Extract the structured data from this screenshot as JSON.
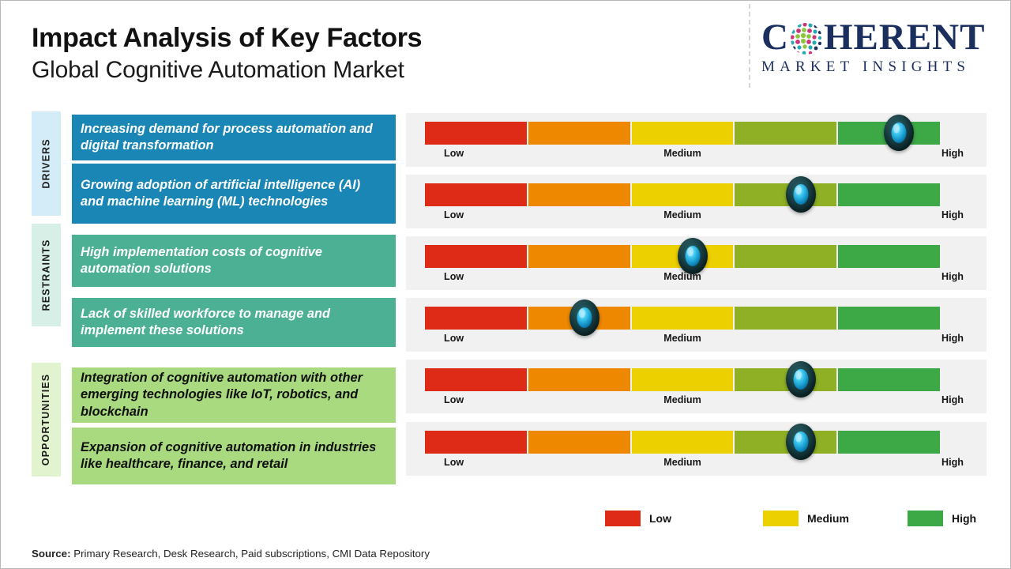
{
  "header": {
    "title": "Impact Analysis of Key Factors",
    "subtitle": "Global Cognitive Automation Market",
    "logo": {
      "name_part1": "C",
      "name_part2": "HERENT",
      "tagline": "MARKET INSIGHTS",
      "globe_colors": [
        "#2aa9b5",
        "#8cc63f",
        "#c9347a",
        "#1b2f5e"
      ],
      "brand_color": "#1b2f5e"
    }
  },
  "categories": [
    {
      "label": "DRIVERS",
      "rail_bg": "#d4ecf7",
      "box_bg": "#1a86b5",
      "text_color": "#ffffff"
    },
    {
      "label": "RESTRAINTS",
      "rail_bg": "#d8efe8",
      "box_bg": "#4cb094",
      "text_color": "#ffffff"
    },
    {
      "label": "OPPORTUNITIES",
      "rail_bg": "#e2f3cf",
      "box_bg": "#aada7f",
      "text_color": "#101010"
    }
  ],
  "scale_labels": {
    "low": "Low",
    "medium": "Medium",
    "high": "High"
  },
  "segment_colors": [
    "#de2b18",
    "#ee8800",
    "#edd000",
    "#8fb024",
    "#3ca846"
  ],
  "rows": [
    {
      "category": 0,
      "text": "Increasing demand for process automation and digital transformation",
      "impact": "High",
      "marker_percent": 92
    },
    {
      "category": 0,
      "text": "Growing adoption of artificial intelligence (AI) and machine learning (ML) technologies",
      "impact": "High",
      "marker_percent": 73
    },
    {
      "category": 1,
      "text": "High implementation costs of cognitive automation solutions",
      "impact": "Medium",
      "marker_percent": 52
    },
    {
      "category": 1,
      "text": "Lack of skilled workforce to manage and implement these solutions",
      "impact": "Low",
      "marker_percent": 31
    },
    {
      "category": 2,
      "text": "Integration of cognitive automation with other emerging technologies like IoT, robotics, and blockchain",
      "impact": "High",
      "marker_percent": 73
    },
    {
      "category": 2,
      "text": "Expansion of cognitive automation in industries like healthcare, finance, and retail",
      "impact": "High",
      "marker_percent": 73
    }
  ],
  "legend": [
    {
      "label": "Low",
      "color": "#de2b18"
    },
    {
      "label": "Medium",
      "color": "#edd000"
    },
    {
      "label": "High",
      "color": "#3ca846"
    }
  ],
  "source": {
    "label": "Source:",
    "text": " Primary Research, Desk Research, Paid subscriptions, CMI Data Repository"
  },
  "chart_data": {
    "type": "bar",
    "title": "Impact Analysis of Key Factors - Global Cognitive Automation Market",
    "xlabel": "",
    "ylabel": "",
    "categories": [
      "Increasing demand for process automation and digital transformation",
      "Growing adoption of artificial intelligence (AI) and machine learning (ML) technologies",
      "High implementation costs of cognitive automation solutions",
      "Lack of skilled workforce to manage and implement these solutions",
      "Integration of cognitive automation with other emerging technologies like IoT, robotics, and blockchain",
      "Expansion of cognitive automation in industries like healthcare, finance, and retail"
    ],
    "values": [
      92,
      73,
      52,
      31,
      73,
      73
    ],
    "value_labels": [
      "High",
      "High",
      "Medium",
      "Low",
      "High",
      "High"
    ],
    "groups": [
      "DRIVERS",
      "DRIVERS",
      "RESTRAINTS",
      "RESTRAINTS",
      "OPPORTUNITIES",
      "OPPORTUNITIES"
    ],
    "tick_labels": [
      "Low",
      "Medium",
      "High"
    ],
    "xlim": [
      0,
      100
    ],
    "grid": false,
    "legend_position": "bottom-right",
    "legend_entries": [
      "Low",
      "Medium",
      "High"
    ]
  }
}
